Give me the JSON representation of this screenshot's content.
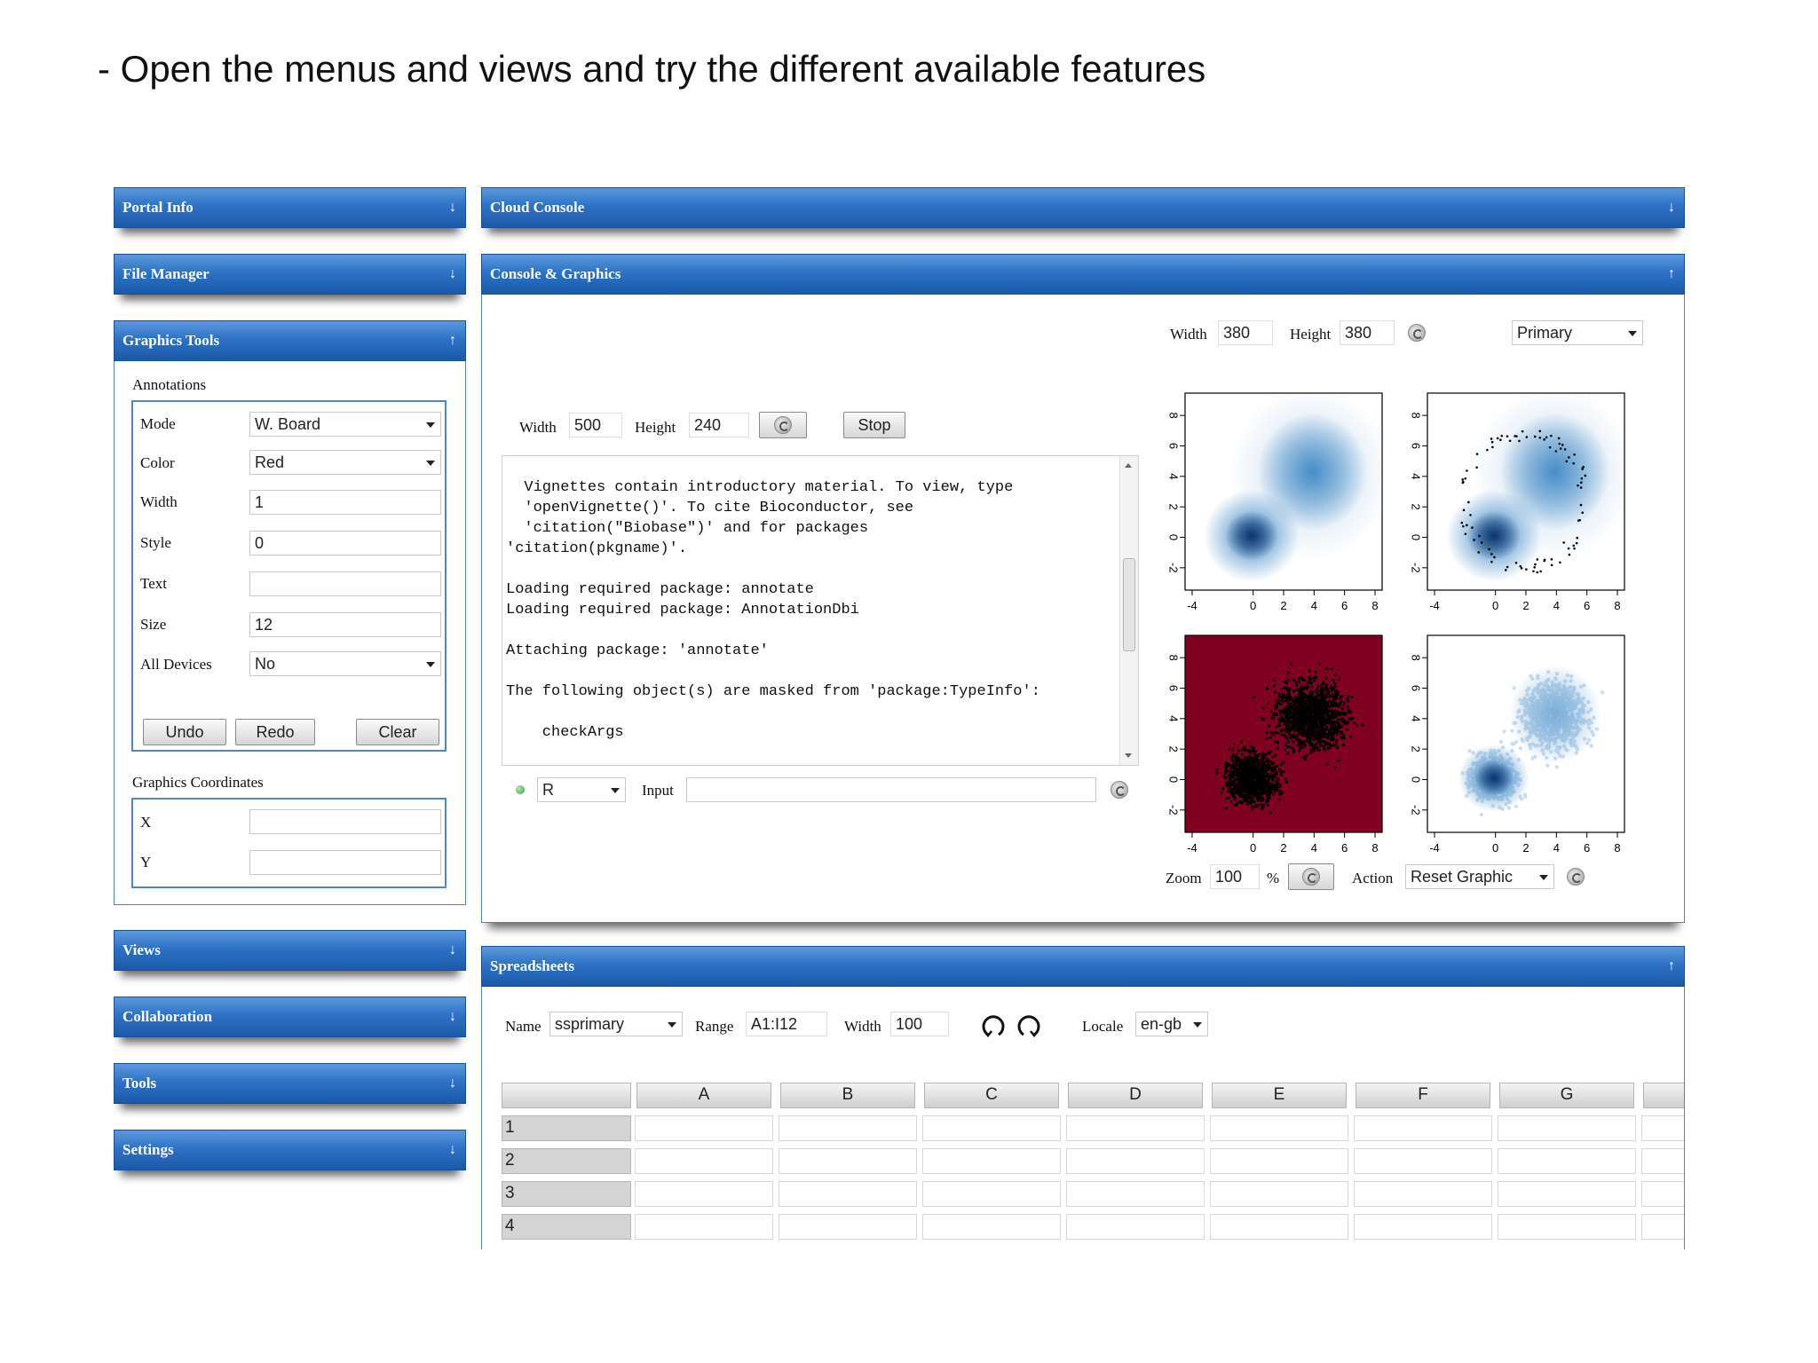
{
  "slide": {
    "title": "- Open the menus and views and try the different available features"
  },
  "sidebar": {
    "panels": [
      {
        "label": "Portal Info",
        "collapsed": true
      },
      {
        "label": "File Manager",
        "collapsed": true
      },
      {
        "label": "Graphics Tools",
        "collapsed": false
      },
      {
        "label": "Views",
        "collapsed": true
      },
      {
        "label": "Collaboration",
        "collapsed": true
      },
      {
        "label": "Tools",
        "collapsed": true
      },
      {
        "label": "Settings",
        "collapsed": true
      }
    ],
    "annotations": {
      "heading": "Annotations",
      "mode": {
        "label": "Mode",
        "value": "W. Board"
      },
      "color": {
        "label": "Color",
        "value": "Red"
      },
      "width": {
        "label": "Width",
        "value": "1"
      },
      "style": {
        "label": "Style",
        "value": "0"
      },
      "text": {
        "label": "Text",
        "value": ""
      },
      "size": {
        "label": "Size",
        "value": "12"
      },
      "all_devices": {
        "label": "All Devices",
        "value": "No"
      },
      "undo": "Undo",
      "redo": "Redo",
      "clear": "Clear"
    },
    "coordinates": {
      "heading": "Graphics Coordinates",
      "x": {
        "label": "X",
        "value": ""
      },
      "y": {
        "label": "Y",
        "value": ""
      }
    }
  },
  "cloud_console": {
    "title": "Cloud Console"
  },
  "console_graphics": {
    "title": "Console & Graphics",
    "console": {
      "width_label": "Width",
      "width_value": "500",
      "height_label": "Height",
      "height_value": "240",
      "stop": "Stop",
      "output": "  Vignettes contain introductory material. To view, type\n  'openVignette()'. To cite Bioconductor, see\n  'citation(\"Biobase\")' and for packages\n'citation(pkgname)'.\n\nLoading required package: annotate\nLoading required package: AnnotationDbi\n\nAttaching package: 'annotate'\n\nThe following object(s) are masked from 'package:TypeInfo':\n\n    checkArgs",
      "language": "R",
      "input_label": "Input",
      "input_value": ""
    },
    "graphics": {
      "width_label": "Width",
      "width_value": "380",
      "height_label": "Height",
      "height_value": "380",
      "device": "Primary",
      "zoom_label": "Zoom",
      "zoom_value": "100",
      "zoom_unit": "%",
      "action_label": "Action",
      "action_value": "Reset Graphic",
      "x_ticks": [
        "-4",
        "0",
        "2",
        "4",
        "6",
        "8"
      ],
      "y_ticks": [
        "-2",
        "0",
        "2",
        "4",
        "6",
        "8"
      ],
      "colors": {
        "blue_dark": "#08306b",
        "blue_mid": "#2f7fc0",
        "blue_light": "#c6dbef",
        "maroon": "#800020"
      }
    }
  },
  "spreadsheets": {
    "title": "Spreadsheets",
    "name_label": "Name",
    "name_value": "ssprimary",
    "range_label": "Range",
    "range_value": "A1:I12",
    "width_label": "Width",
    "width_value": "100",
    "locale_label": "Locale",
    "locale_value": "en-gb",
    "columns": [
      "A",
      "B",
      "C",
      "D",
      "E",
      "F",
      "G"
    ],
    "rows": [
      "1",
      "2",
      "3",
      "4"
    ]
  }
}
